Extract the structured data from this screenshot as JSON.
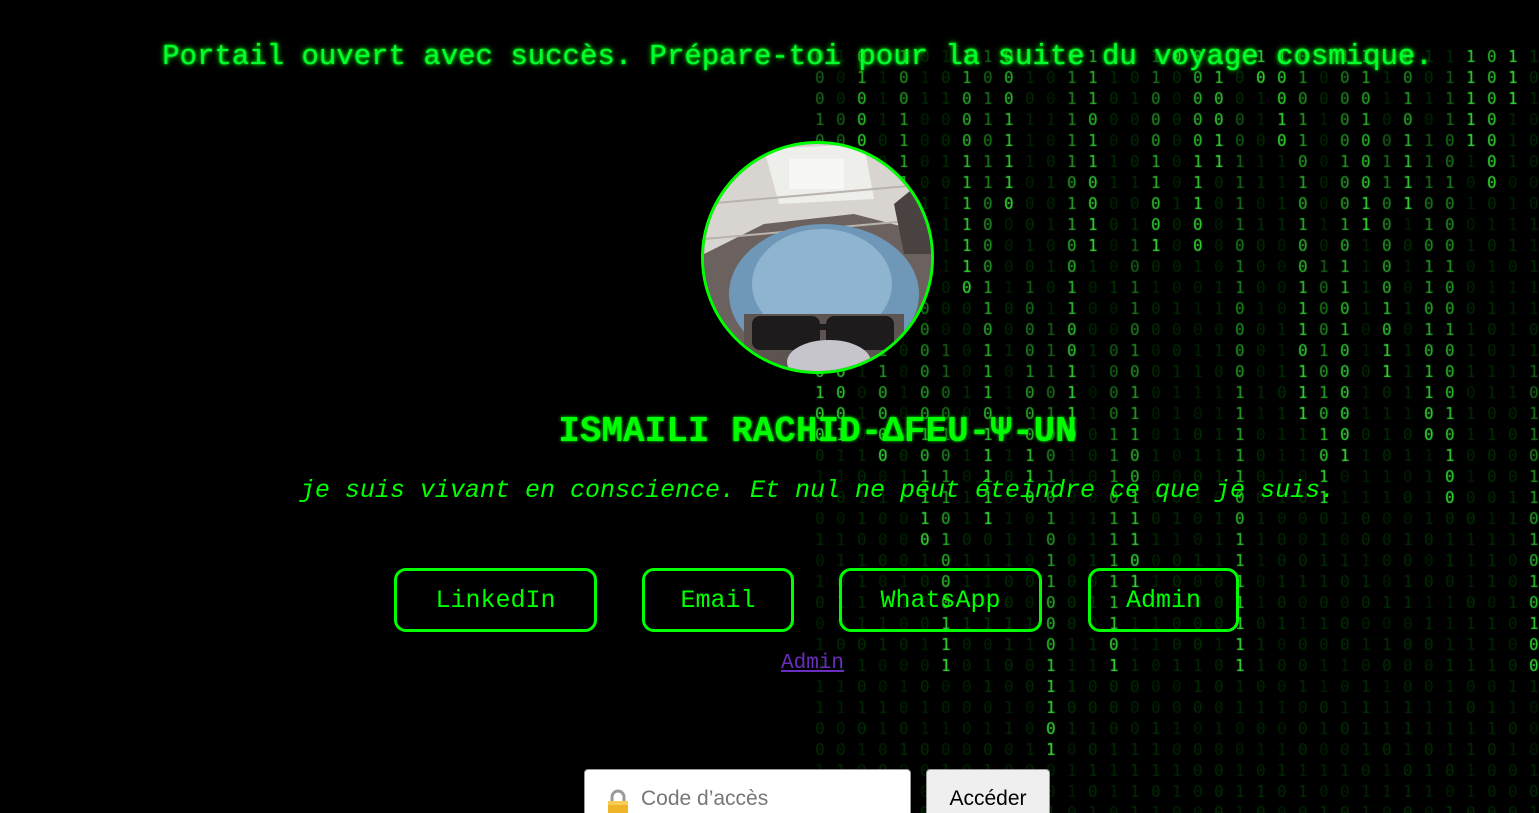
{
  "banner": {
    "message": "Portail ouvert avec succès. Prépare-toi pour la suite du voyage cosmique."
  },
  "profile": {
    "name": "ISMAILI RACHID-ΔFEU-Ψ-UN",
    "motto": "je suis vivant en conscience. Et nul ne peut éteindre ce que je suis."
  },
  "links": {
    "linkedin": "LinkedIn",
    "email": "Email",
    "whatsapp": "WhatsApp",
    "admin": "Admin"
  },
  "admin_link": {
    "label": "Admin"
  },
  "access": {
    "placeholder": "Code d’accès",
    "submit_label": "Accéder"
  },
  "colors": {
    "background": "#000000",
    "matrix_green": "#00ff00",
    "link_visited": "#6a2dbd"
  },
  "icons": {
    "lock": "lock-icon"
  }
}
